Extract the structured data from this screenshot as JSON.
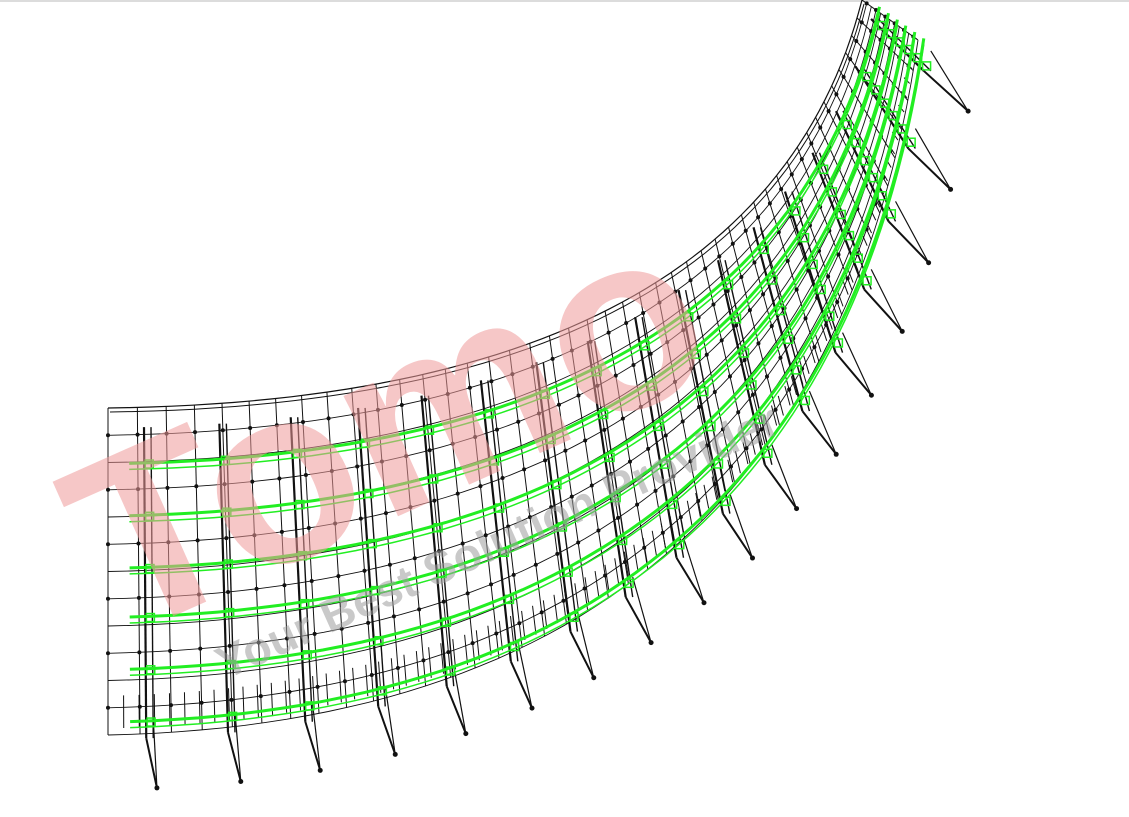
{
  "drawing": {
    "description_type": "curved-led-screen-truss-structure",
    "colors": {
      "background": "#ffffff",
      "frame": "#111111",
      "beam": "#22ee22",
      "watermark": "#ef9a9a",
      "watermark_tagline": "#9e9e9e"
    }
  },
  "watermark": {
    "brand": "Tomo",
    "tagline": "Your Best Solution Provider"
  }
}
